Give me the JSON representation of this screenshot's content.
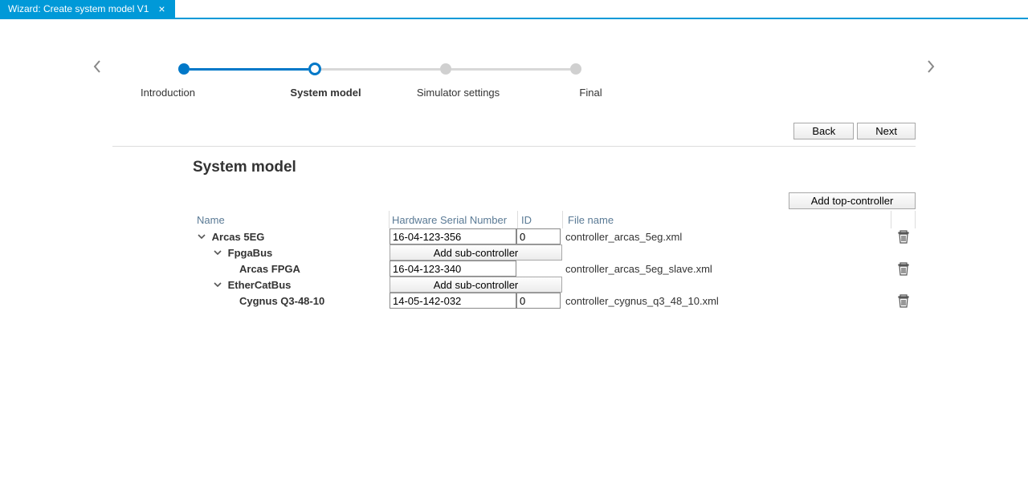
{
  "tab": {
    "title": "Wizard: Create system model V1"
  },
  "stepper": {
    "steps": [
      "Introduction",
      "System model",
      "Simulator settings",
      "Final"
    ],
    "current_index": 1
  },
  "nav": {
    "back": "Back",
    "next": "Next"
  },
  "section": {
    "title": "System model"
  },
  "buttons": {
    "add_top": "Add top-controller",
    "add_sub": "Add sub-controller"
  },
  "columns": {
    "name": "Name",
    "hw": "Hardware Serial Number",
    "id": "ID",
    "file": "File name"
  },
  "tree": {
    "root": {
      "name": "Arcas 5EG",
      "hw": "16-04-123-356",
      "id": "0",
      "file": "controller_arcas_5eg.xml"
    },
    "bus1": {
      "name": "FpgaBus"
    },
    "leaf1": {
      "name": "Arcas FPGA",
      "hw": "16-04-123-340",
      "file": "controller_arcas_5eg_slave.xml"
    },
    "bus2": {
      "name": "EtherCatBus"
    },
    "leaf2": {
      "name": "Cygnus Q3-48-10",
      "hw": "14-05-142-032",
      "id": "0",
      "file": "controller_cygnus_q3_48_10.xml"
    }
  }
}
